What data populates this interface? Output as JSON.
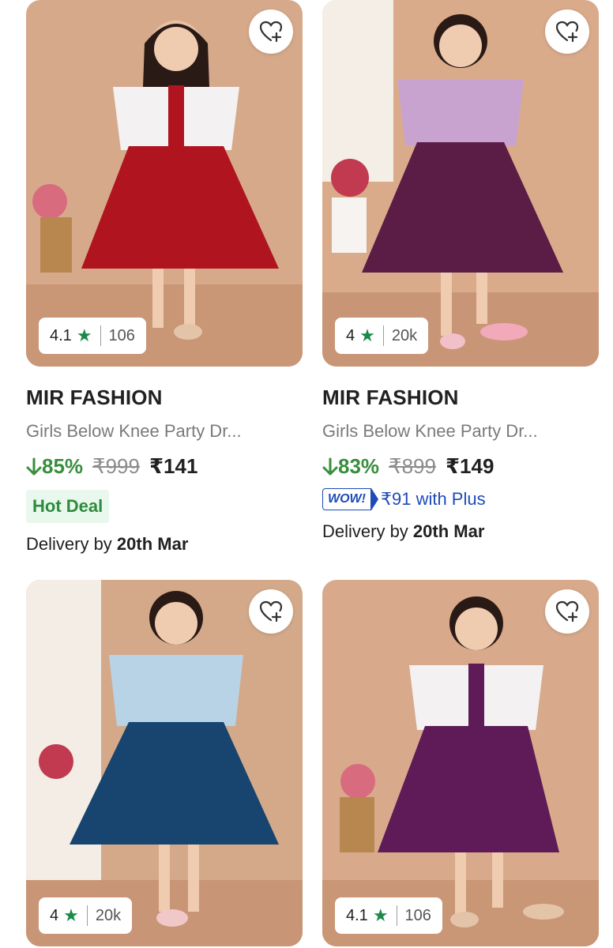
{
  "products": [
    {
      "brand": "MIR FASHION",
      "title": "Girls Below Knee Party Dr...",
      "rating": "4.1",
      "rating_count": "106",
      "discount": "85%",
      "mrp": "₹999",
      "price": "₹141",
      "badge": "Hot Deal",
      "delivery_prefix": "Delivery by ",
      "delivery_date": "20th Mar",
      "colors": {
        "dress": "#b0151f",
        "top": "#f4f1f2",
        "bg": "#d7a98b"
      }
    },
    {
      "brand": "MIR FASHION",
      "title": "Girls Below Knee Party Dr...",
      "rating": "4",
      "rating_count": "20k",
      "discount": "83%",
      "mrp": "₹899",
      "price": "₹149",
      "plus_badge": "WOW!",
      "plus_text": "₹91 with Plus",
      "delivery_prefix": "Delivery by ",
      "delivery_date": "20th Mar",
      "colors": {
        "dress": "#5b1d46",
        "top": "#c9a3cf",
        "bg": "#d9ab8b"
      }
    },
    {
      "rating": "4",
      "rating_count": "20k",
      "colors": {
        "dress": "#17456f",
        "top": "#b9d3e6",
        "bg": "#d3a98a"
      }
    },
    {
      "rating": "4.1",
      "rating_count": "106",
      "colors": {
        "dress": "#5f1b58",
        "top": "#f4f1f3",
        "bg": "#d8aa8b"
      }
    }
  ],
  "icons": {
    "wishlist": "heart-plus-icon",
    "star": "star-icon",
    "discount_arrow": "arrow-down-icon"
  }
}
